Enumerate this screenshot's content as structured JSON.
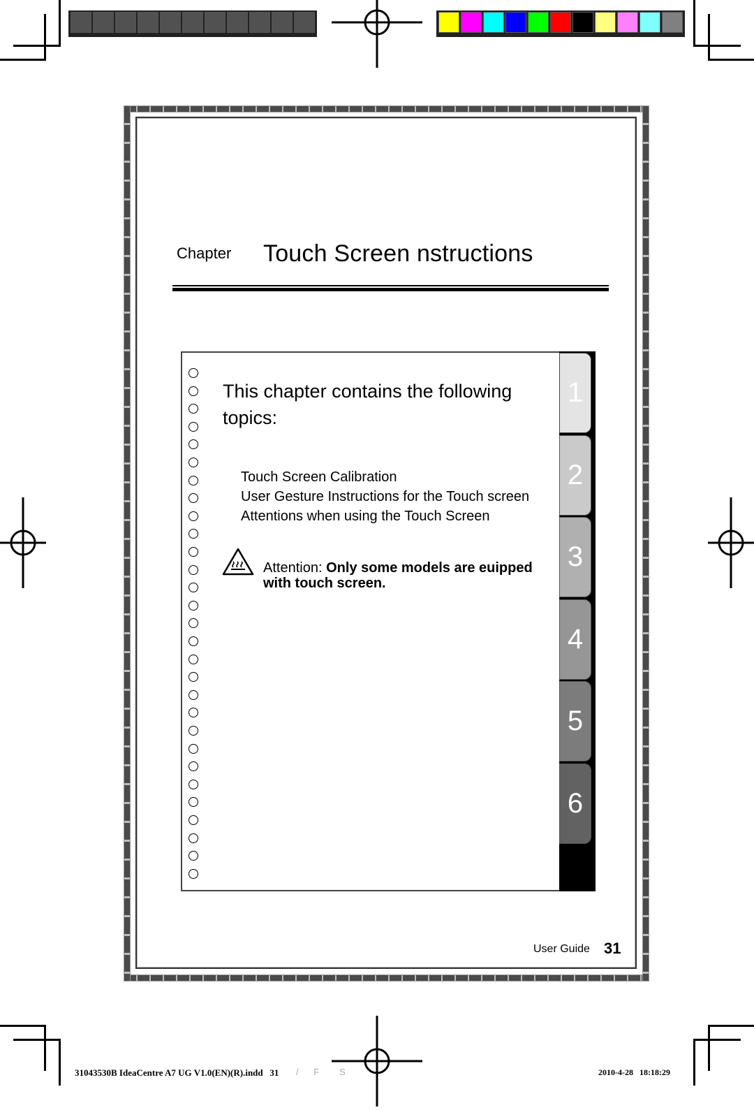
{
  "print_marks": {
    "gray_bar_swatches": 11,
    "color_bar_swatches": [
      "#ffff00",
      "#ff00ff",
      "#00ffff",
      "#0000ff",
      "#00ff00",
      "#ff0000",
      "#000000",
      "#ffff80",
      "#ff80ff",
      "#80ffff",
      "#808080"
    ]
  },
  "chapter": {
    "label": "Chapter",
    "title": "Touch Screen nstructions"
  },
  "content": {
    "intro": "This chapter contains the following topics:",
    "topics": [
      "Touch Screen Calibration",
      "User Gesture Instructions for the Touch screen",
      "Attentions when using the Touch Screen"
    ],
    "attention_label": "Attention: ",
    "attention_text": "Only some models are euipped with touch screen."
  },
  "tabs": [
    {
      "label": "1",
      "color": "#e4e4e4"
    },
    {
      "label": "2",
      "color": "#cacaca"
    },
    {
      "label": "3",
      "color": "#b0b0b0"
    },
    {
      "label": "4",
      "color": "#969696"
    },
    {
      "label": "5",
      "color": "#7c7c7c"
    },
    {
      "label": "6",
      "color": "#626262"
    }
  ],
  "footer": {
    "label": "User Guide",
    "page": "31"
  },
  "slug": {
    "file": "31043530B IdeaCentre A7 UG V1.0(EN)(R).indd   31",
    "ghost": "/      F        S    ",
    "datetime": "2010-4-28   18:18:29"
  }
}
